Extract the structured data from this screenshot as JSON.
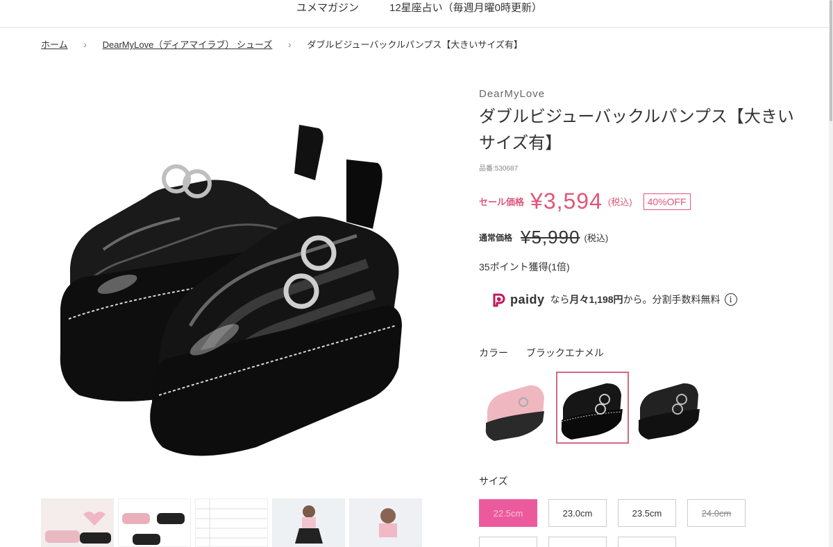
{
  "nav": {
    "items": [
      "ユメマガジン",
      "12星座占い（毎週月曜0時更新）"
    ]
  },
  "breadcrumb": {
    "home": "ホーム",
    "category": "DearMyLove（ディアマイラブ） シューズ",
    "current": "ダブルビジューバックルパンプス【大きいサイズ有】",
    "sep": "›"
  },
  "product": {
    "brand": "DearMyLove",
    "title": "ダブルビジューバックルパンプス【大きいサイズ有】",
    "code": "品番:530687",
    "sale_label": "セール価格",
    "sale_price": "¥3,594",
    "sale_tax": "(税込)",
    "discount": "40%OFF",
    "regular_label": "通常価格",
    "regular_price": "¥5,990",
    "regular_tax": "(税込)",
    "points": "35ポイント獲得(1倍)"
  },
  "paidy": {
    "logo": "paidy",
    "pre": "なら",
    "amount": "月々1,198円",
    "post": "から。分割手数料無料",
    "info_icon": "i"
  },
  "color": {
    "label": "カラー",
    "selected": "ブラックエナメル",
    "swatches": [
      "pink-shoe",
      "black-enamel-shoe",
      "black-shoe"
    ],
    "selected_index": 1
  },
  "size": {
    "label": "サイズ",
    "options": [
      {
        "label": "22.5cm",
        "state": "active"
      },
      {
        "label": "23.0cm",
        "state": "normal"
      },
      {
        "label": "23.5cm",
        "state": "normal"
      },
      {
        "label": "24.0cm",
        "state": "soldout"
      }
    ]
  },
  "colors": {
    "accent": "#e0567a",
    "size_active": "#ec5a9e",
    "swatch_border": "#d36a82"
  }
}
